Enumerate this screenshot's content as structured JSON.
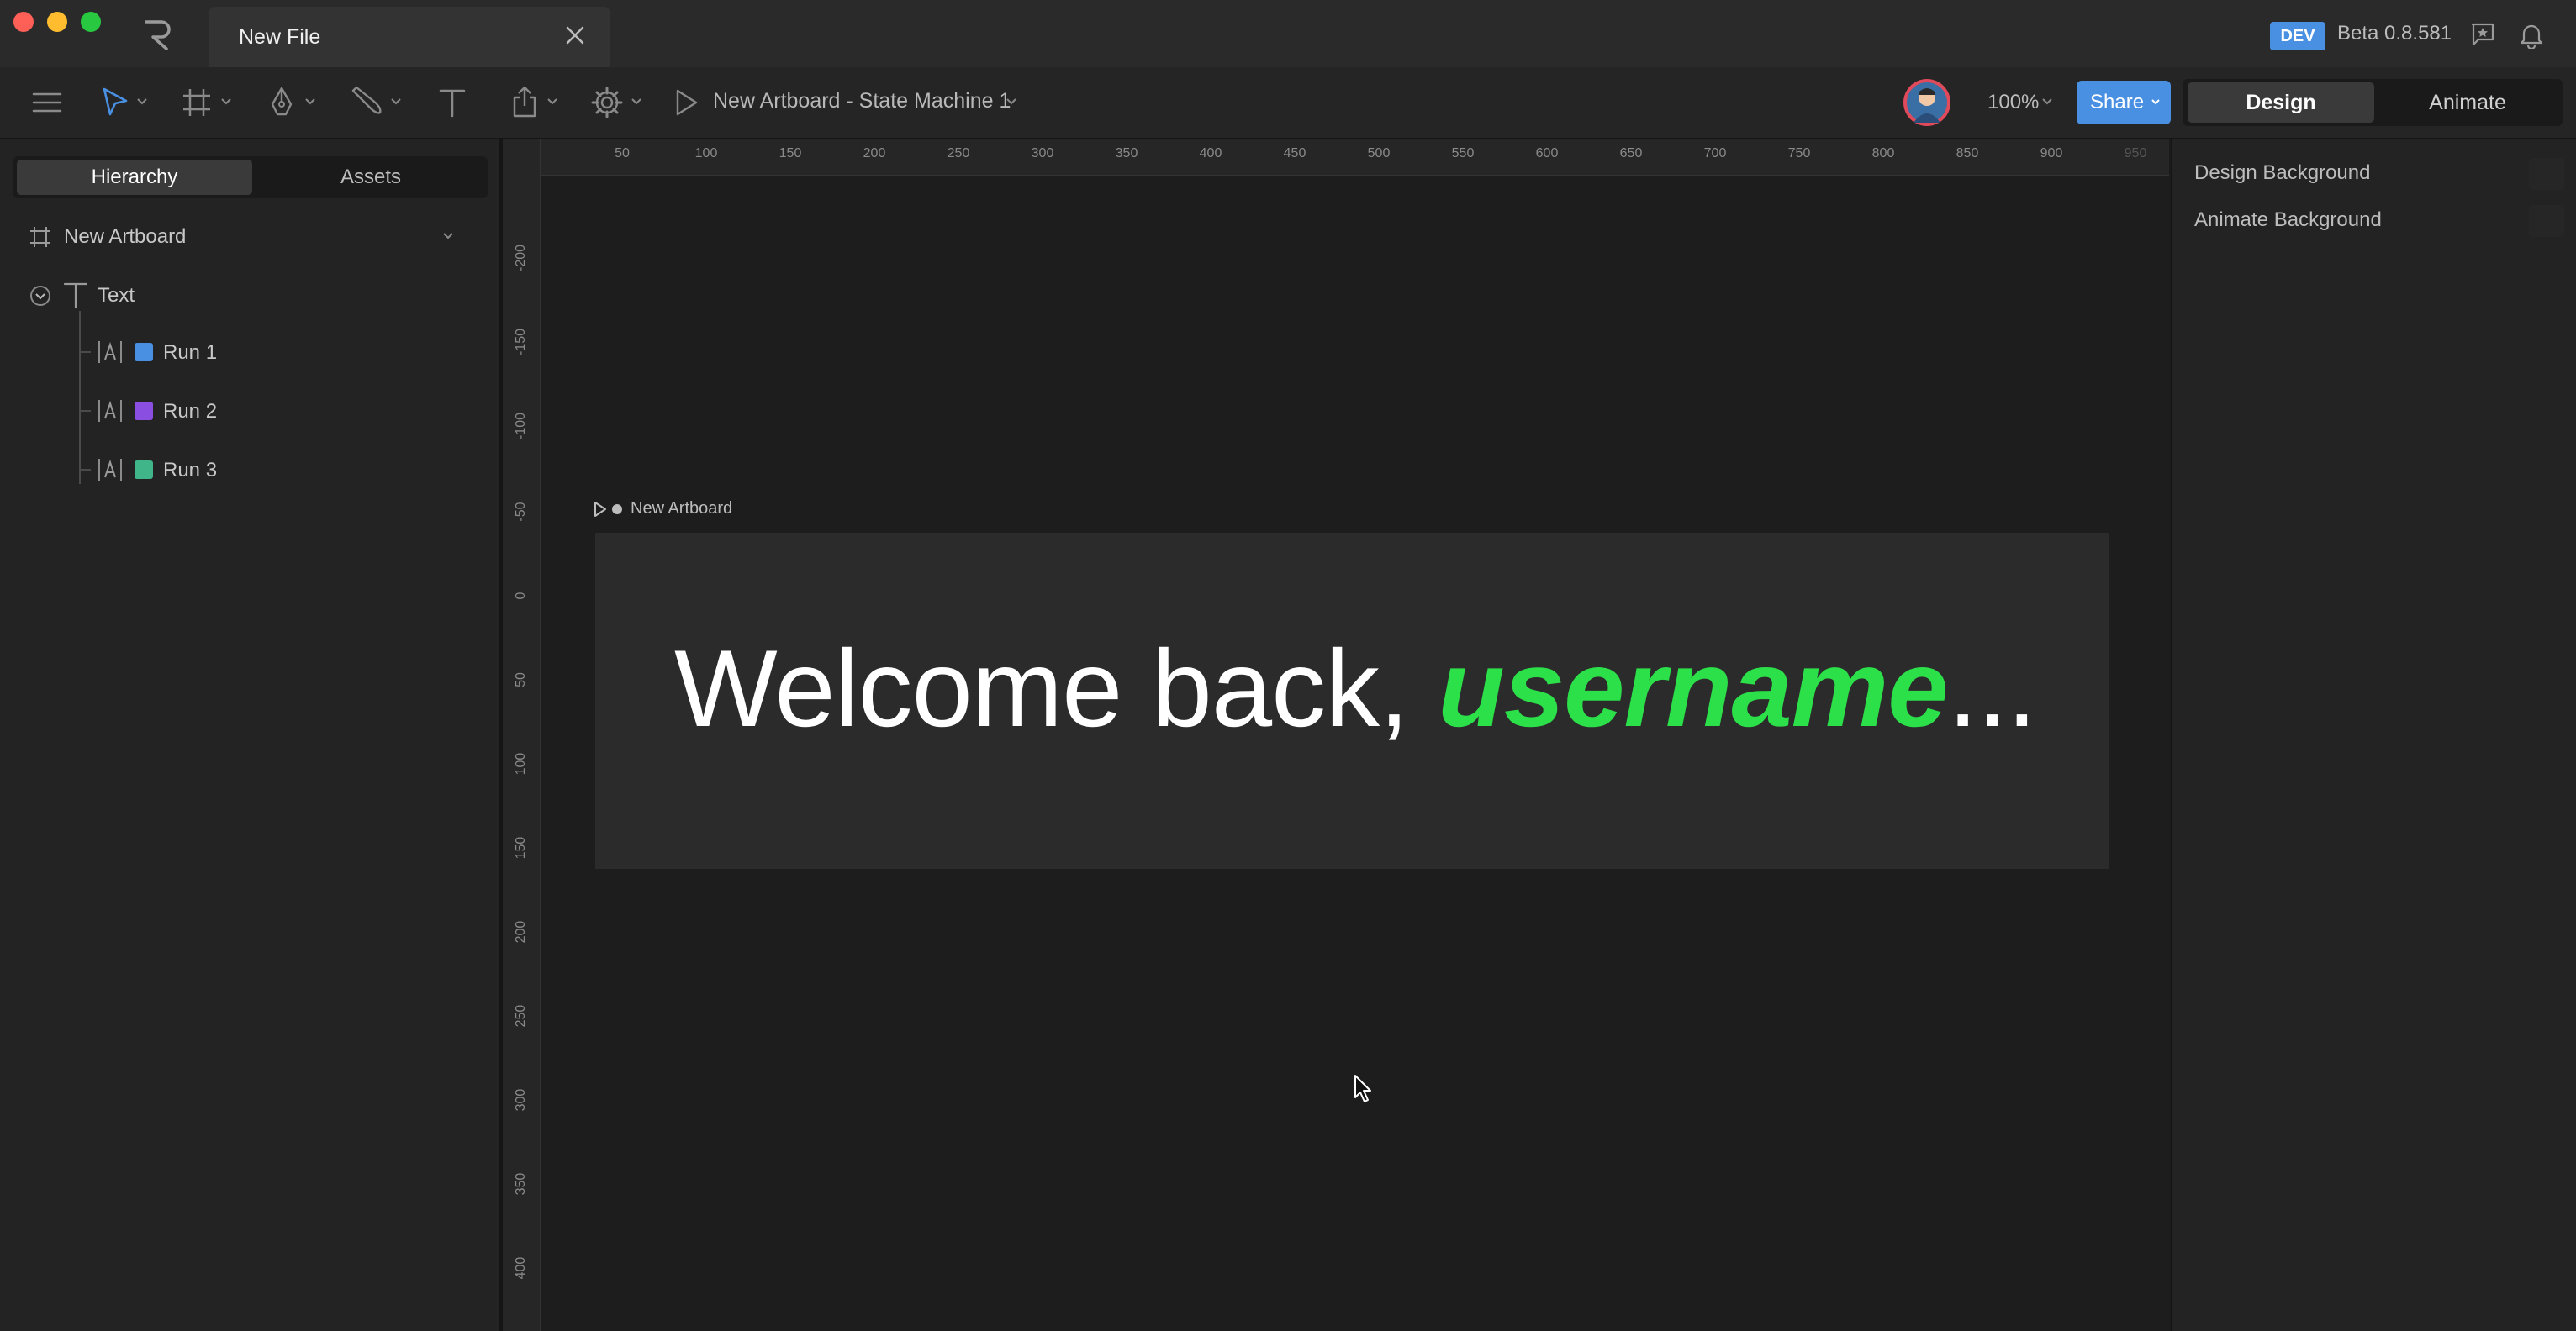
{
  "titlebar": {
    "tab_title": "New File",
    "dev_badge": "DEV",
    "version": "Beta 0.8.581"
  },
  "toolbar": {
    "state_machine_title": "New Artboard - State Machine 1",
    "zoom": "100%",
    "share_label": "Share",
    "mode_design": "Design",
    "mode_animate": "Animate"
  },
  "left_panel": {
    "tabs": [
      "Hierarchy",
      "Assets"
    ],
    "artboard_name": "New Artboard",
    "text_node": "Text",
    "runs": [
      {
        "label": "Run 1",
        "color": "#4a90e2"
      },
      {
        "label": "Run 2",
        "color": "#8a4fe0"
      },
      {
        "label": "Run 3",
        "color": "#3fb589"
      }
    ]
  },
  "canvas": {
    "ruler_top_ticks": [
      "50",
      "100",
      "150",
      "200",
      "250",
      "300",
      "350",
      "400",
      "450",
      "500",
      "550",
      "600",
      "650",
      "700",
      "750",
      "800",
      "850",
      "900",
      "950"
    ],
    "ruler_left_ticks": [
      "-200",
      "-150",
      "-100",
      "-50",
      "0",
      "50",
      "100",
      "150",
      "200",
      "250",
      "300",
      "350",
      "400"
    ],
    "artboard_label": "New Artboard",
    "welcome_prefix": "Welcome back, ",
    "welcome_username": "username",
    "welcome_suffix": "...",
    "colors": {
      "username": "#2ce04a",
      "artboard_bg": "#2b2b2b"
    }
  },
  "right_panel": {
    "design_background": "Design Background",
    "animate_background": "Animate Background"
  }
}
